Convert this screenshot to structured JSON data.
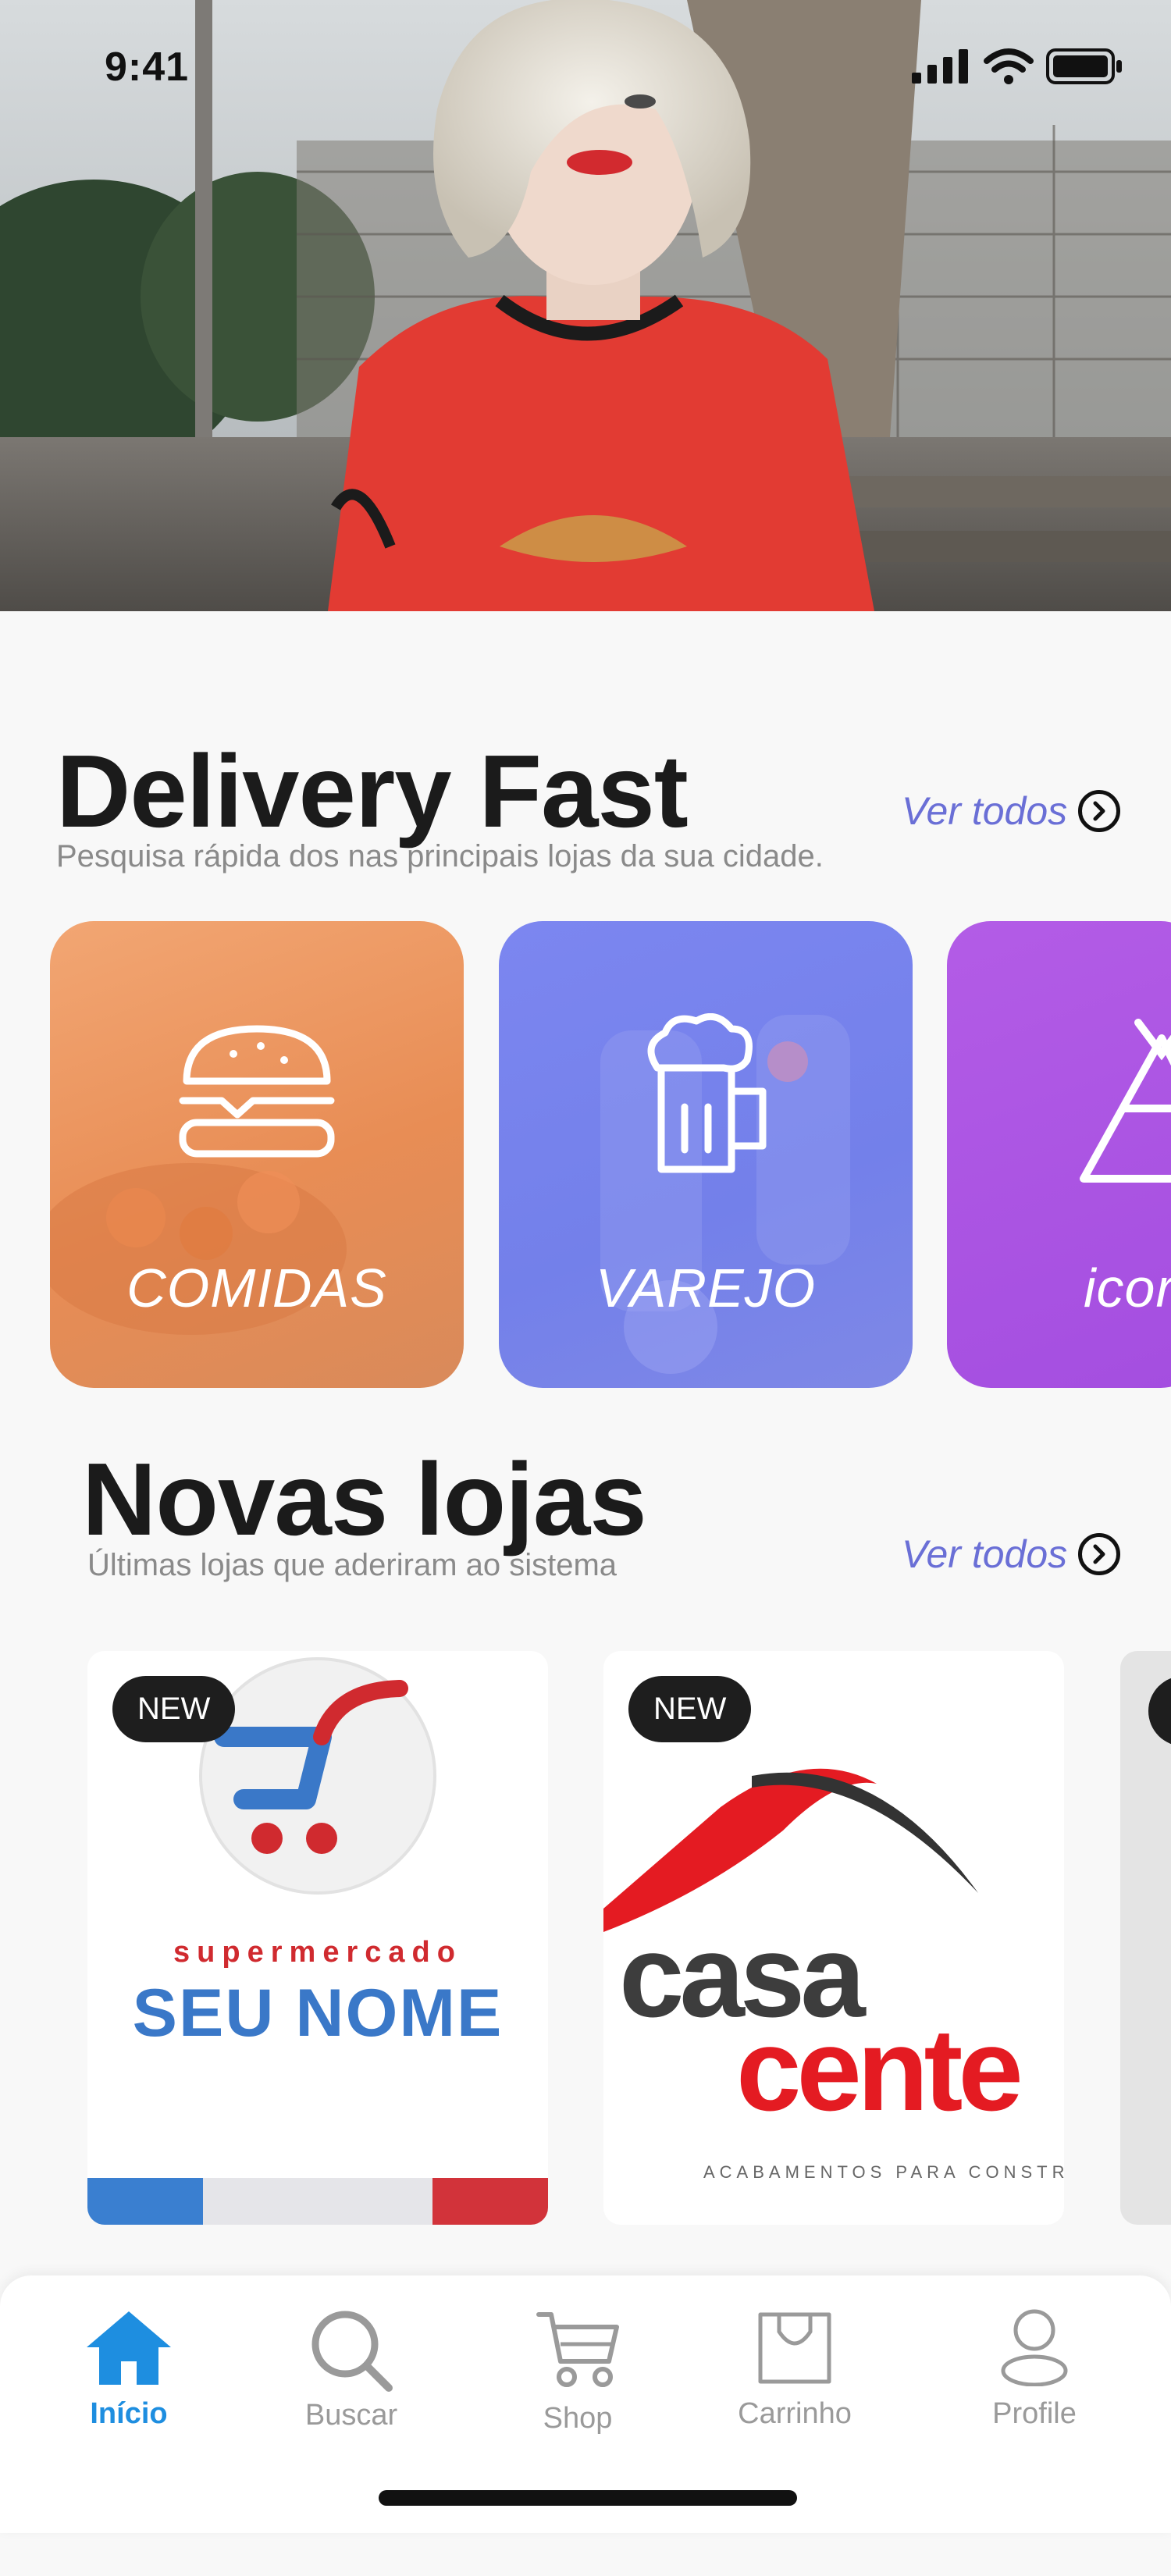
{
  "status_bar": {
    "time": "9:41",
    "icons": [
      "signal-icon",
      "wifi-icon",
      "battery-icon"
    ]
  },
  "hero": {
    "image": "woman-red-tshirt-photo"
  },
  "delivery": {
    "title": "Delivery Fast",
    "subtitle": "Pesquisa rápida dos nas principais lojas da sua cidade.",
    "see_all": "Ver todos",
    "categories": [
      {
        "label": "COMIDAS",
        "icon": "burger-icon",
        "color": "#ee9962"
      },
      {
        "label": "VAREJO",
        "icon": "beer-mug-icon",
        "color": "#7882ec"
      },
      {
        "label": "icor",
        "icon": "tent-icon",
        "color": "#a752e2"
      }
    ]
  },
  "new_stores": {
    "title": "Novas lojas",
    "subtitle": "Últimas lojas que aderiram ao sistema",
    "see_all": "Ver todos",
    "stores": [
      {
        "badge": "NEW",
        "line1": "supermercado",
        "line2": "SEU NOME"
      },
      {
        "badge": "NEW",
        "line1": "casa",
        "line2": "cente",
        "tagline": "ACABAMENTOS PARA CONSTRU"
      }
    ]
  },
  "tabbar": {
    "tabs": [
      {
        "label": "Início",
        "icon": "home-icon",
        "active": true
      },
      {
        "label": "Buscar",
        "icon": "search-icon",
        "active": false
      },
      {
        "label": "Shop",
        "icon": "cart-icon",
        "active": false
      },
      {
        "label": "Carrinho",
        "icon": "shopping-bag-icon",
        "active": false
      },
      {
        "label": "Profile",
        "icon": "profile-icon",
        "active": false
      }
    ]
  },
  "colors": {
    "accent": "#6a6fd6",
    "active_tab": "#1e8ee0",
    "title": "#1b1b1b"
  }
}
